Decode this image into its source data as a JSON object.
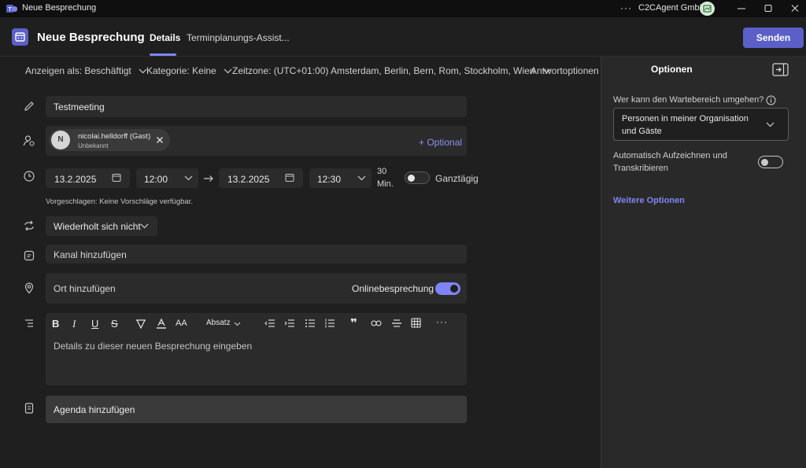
{
  "window": {
    "title": "Neue Besprechung",
    "org": "C2CAgent GmbH",
    "more": "···"
  },
  "header": {
    "title": "Neue Besprechung",
    "tabs": [
      "Details",
      "Terminplanungs-Assist..."
    ],
    "send_label": "Senden"
  },
  "options_bar": {
    "show_as": "Anzeigen als: Beschäftigt",
    "category": "Kategorie: Keine",
    "timezone": "Zeitzone: (UTC+01:00) Amsterdam, Berlin, Bern, Rom, Stockholm, Wien",
    "response": "Antwortoptionen"
  },
  "form": {
    "title_value": "Testmeeting",
    "attendee": {
      "initial": "N",
      "name": "nicolai.helldorff (Gast)",
      "status": "Unbekannt"
    },
    "optional_label": "+ Optional",
    "start_date": "13.2.2025",
    "start_time": "12:00",
    "end_date": "13.2.2025",
    "end_time": "12:30",
    "duration_num": "30",
    "duration_unit": "Min.",
    "all_day_label": "Ganztägig",
    "suggestion": "Vorgeschlagen: Keine Vorschläge verfügbar.",
    "recurrence": "Wiederholt sich nicht",
    "channel": "Kanal hinzufügen",
    "location": "Ort hinzufügen",
    "online_label": "Onlinebesprechung",
    "paragraph_style": "Absatz",
    "details_placeholder": "Details zu dieser neuen Besprechung eingeben",
    "agenda": "Agenda hinzufügen"
  },
  "panel": {
    "title": "Optionen",
    "lobby_label": "Wer kann den Wartebereich umgehen?",
    "lobby_value_line1": "Personen in meiner Organisation",
    "lobby_value_line2": "und Gäste",
    "record_line1": "Automatisch Aufzeichnen und",
    "record_line2": "Transkribieren",
    "more_options": "Weitere Optionen"
  },
  "colors": {
    "accent": "#5b5fc7",
    "accent_light": "#7f85f5",
    "background": "#1f1f1f",
    "panel": "#292929",
    "field": "#2b2b2b"
  },
  "toggles": {
    "all_day": false,
    "online_meeting": true,
    "auto_record": false
  }
}
